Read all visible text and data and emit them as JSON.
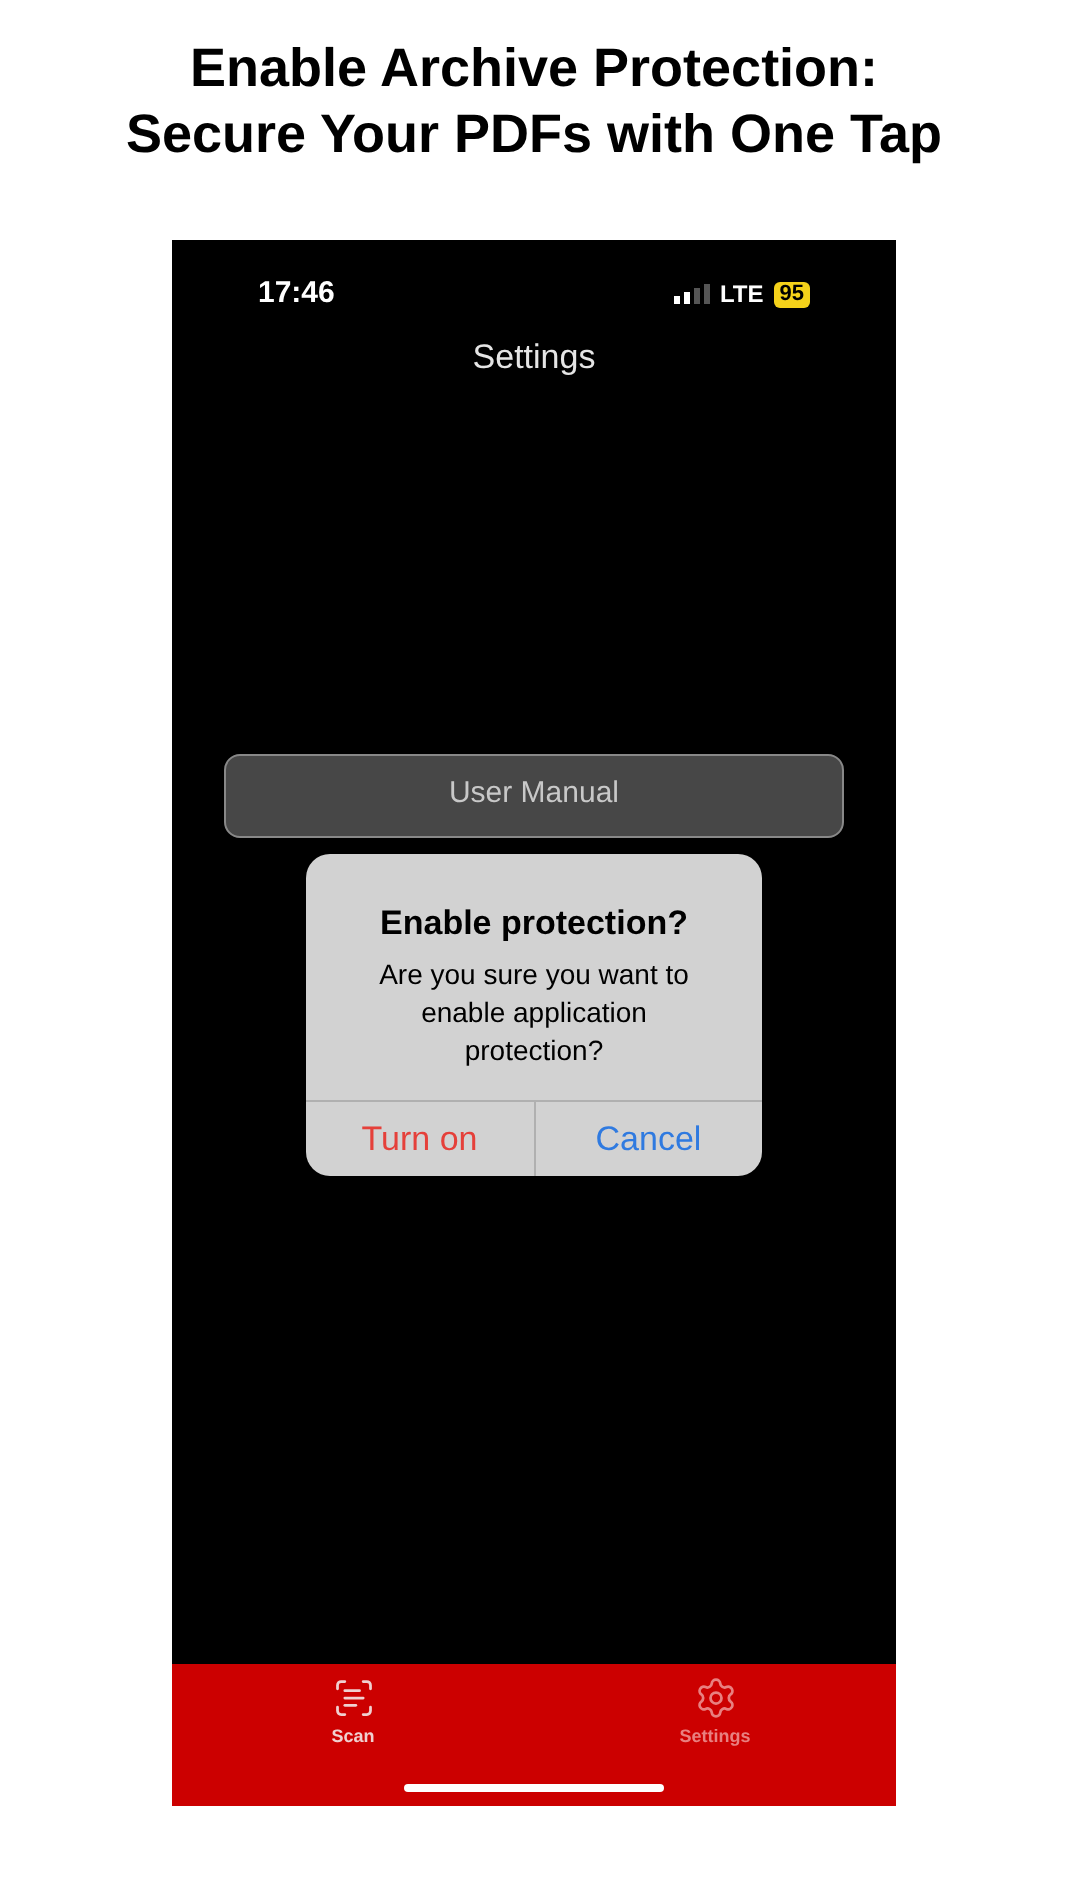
{
  "headline": "Enable Archive Protection:\nSecure Your PDFs with One Tap",
  "status_bar": {
    "time": "17:46",
    "network": "LTE",
    "battery": "95"
  },
  "nav": {
    "title": "Settings"
  },
  "menu_button": {
    "label": "User Manual"
  },
  "dialog": {
    "title": "Enable protection?",
    "message": "Are you sure you want to enable application protection?",
    "actions": [
      {
        "label": "Turn on",
        "kind": "destructive"
      },
      {
        "label": "Cancel",
        "kind": "default"
      }
    ]
  },
  "tab_bar": [
    {
      "label": "Scan",
      "kind": "scan",
      "selected": true
    },
    {
      "label": "Settings",
      "kind": "settings",
      "selected": false
    }
  ]
}
